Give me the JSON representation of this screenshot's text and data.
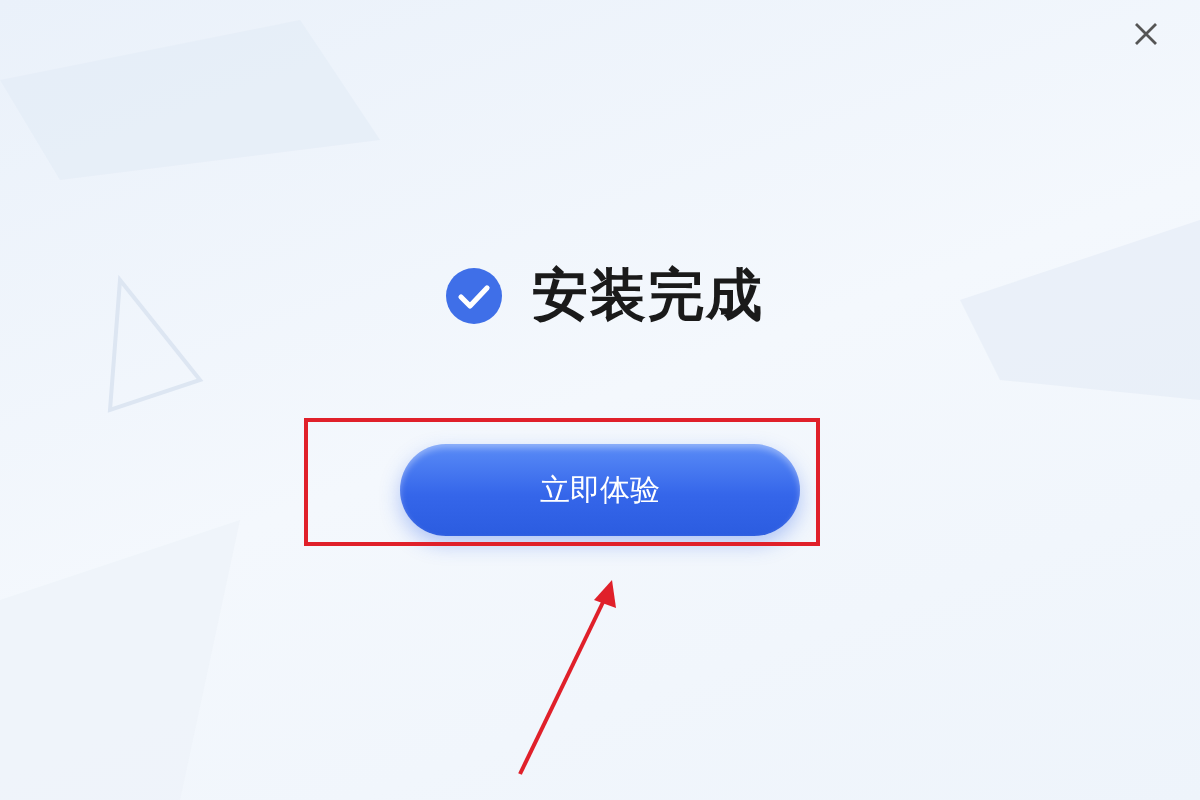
{
  "heading": {
    "title": "安装完成"
  },
  "primary_button": {
    "label": "立即体验"
  }
}
